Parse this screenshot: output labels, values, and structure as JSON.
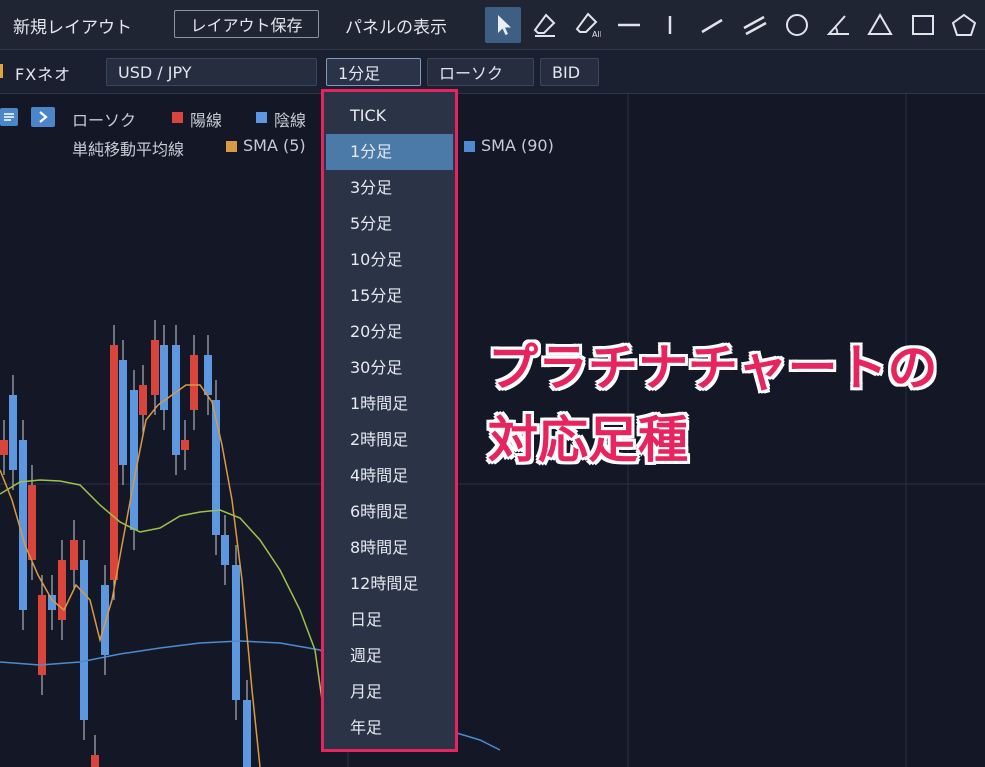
{
  "toolbar": {
    "layout_title": "新規レイアウト",
    "save_label": "レイアウト保存",
    "panel_label": "パネルの表示",
    "tools": [
      "cursor-icon",
      "eraser-icon",
      "eraser-all-icon",
      "horizontal-line-icon",
      "vertical-line-icon",
      "trend-line-icon",
      "parallel-lines-icon",
      "circle-icon",
      "angle-icon",
      "triangle-icon",
      "rectangle-icon",
      "pentagon-icon"
    ],
    "eraser_all_sub": "All"
  },
  "symbolbar": {
    "provider": "FXネオ",
    "symbol": "USD / JPY",
    "timeframe": "1分足",
    "chart_type": "ローソク",
    "price_type": "BID"
  },
  "legend": {
    "candle_label": "ローソク",
    "up_label": "陽線",
    "down_label": "陰線",
    "sma_group": "単純移動平均線",
    "sma5": "SMA (5)",
    "sma90": "SMA (90)"
  },
  "colors": {
    "up": "#d9453a",
    "down": "#5c97e0",
    "sma5": "#d89a45",
    "sma25": "#9cc24c",
    "sma90": "#4d8ad0",
    "highlight": "#e8245f"
  },
  "dropdown": {
    "selected": "1分足",
    "items": [
      "TICK",
      "1分足",
      "3分足",
      "5分足",
      "10分足",
      "15分足",
      "20分足",
      "30分足",
      "1時間足",
      "2時間足",
      "4時間足",
      "6時間足",
      "8時間足",
      "12時間足",
      "日足",
      "週足",
      "月足",
      "年足"
    ]
  },
  "annotation": {
    "line1": "プラチナチャートの",
    "line2": "対応足種"
  }
}
